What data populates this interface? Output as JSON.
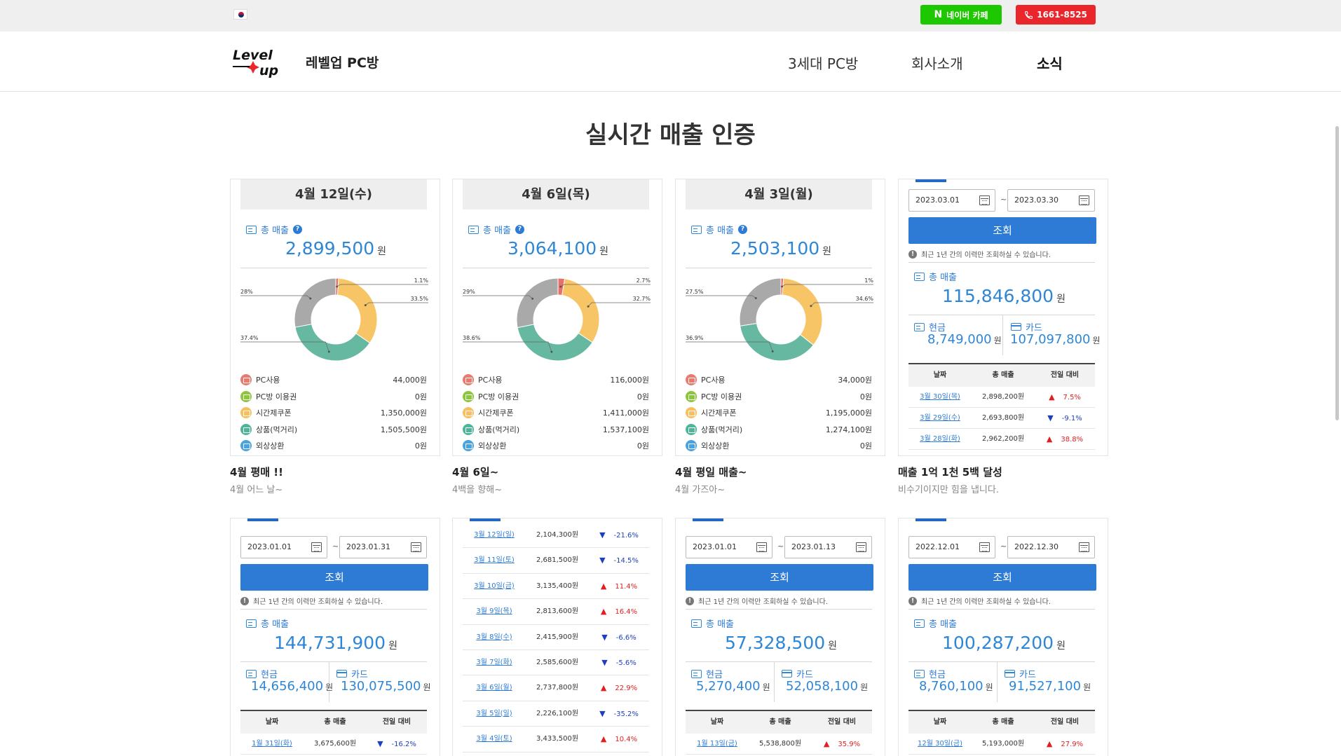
{
  "topbar": {
    "naver_label": "네이버 카페",
    "phone_label": "1661-8525"
  },
  "header": {
    "brand": "레벨업 PC방",
    "nav": [
      "3세대 PC방",
      "회사소개",
      "소식"
    ],
    "active_nav": "소식"
  },
  "page_title": "실시간 매출 인증",
  "total_label": "총 매출",
  "won": "원",
  "legend_labels": [
    "PC사용",
    "PC방 이용권",
    "시간제쿠폰",
    "상품(먹거리)",
    "외상상환"
  ],
  "legend_colors": [
    "#e87a6e",
    "#8cc63f",
    "#f7bf5e",
    "#4fb59a",
    "#4aa3df"
  ],
  "chart_colors": {
    "pc": "#e8706a",
    "coupon": "#f7c565",
    "goods": "#67b8a0",
    "other": "#a9a9a9"
  },
  "daily_cards": [
    {
      "date": "4월 12일(수)",
      "total": "2,899,500",
      "amounts": [
        "44,000원",
        "0원",
        "1,350,000원",
        "1,505,500원",
        "0원"
      ],
      "pcts": {
        "pc": "1.1%",
        "coupon": "33.5%",
        "goods": "37.4%",
        "other": "28%"
      },
      "pct_values": [
        1.1,
        33.5,
        37.4,
        28
      ],
      "caption_title": "4월 평매 !!",
      "caption_sub": "4월 어느 날~"
    },
    {
      "date": "4월 6일(목)",
      "total": "3,064,100",
      "amounts": [
        "116,000원",
        "0원",
        "1,411,000원",
        "1,537,100원",
        "0원"
      ],
      "pcts": {
        "pc": "2.7%",
        "coupon": "32.7%",
        "goods": "38.6%",
        "other": "29%"
      },
      "pct_values": [
        2.7,
        32.7,
        38.6,
        29
      ],
      "caption_title": "4월 6일~",
      "caption_sub": "4백을 향해~"
    },
    {
      "date": "4월 3일(월)",
      "total": "2,503,100",
      "amounts": [
        "34,000원",
        "0원",
        "1,195,000원",
        "1,274,100원",
        "0원"
      ],
      "pcts": {
        "pc": "1%",
        "coupon": "34.6%",
        "goods": "36.9%",
        "other": "27.5%"
      },
      "pct_values": [
        1,
        34.6,
        36.9,
        27.5
      ],
      "caption_title": "4월 평일 매출~",
      "caption_sub": "4월 가즈아~"
    }
  ],
  "range_labels": {
    "search": "조회",
    "notice": "최근 1년 간의 이력만 조회하실 수 있습니다.",
    "cash": "현금",
    "card": "카드",
    "col_date": "날짜",
    "col_total": "총 매출",
    "col_compare": "전일 대비"
  },
  "range_card_march": {
    "start": "2023.03.01",
    "end": "2023.03.30",
    "total": "115,846,800",
    "cash": "8,749,000",
    "card": "107,097,800",
    "rows": [
      {
        "date": "3월 30일(목)",
        "total": "2,898,200원",
        "dir": "up",
        "change": "7.5%"
      },
      {
        "date": "3월 29일(수)",
        "total": "2,693,800원",
        "dir": "down",
        "change": "-9.1%"
      },
      {
        "date": "3월 28일(화)",
        "total": "2,962,200원",
        "dir": "up",
        "change": "38.8%"
      }
    ],
    "caption_title": "매출 1억 1천 5백 달성",
    "caption_sub": "비수기이지만 힘을 냅니다."
  },
  "range_card_jan": {
    "start": "2023.01.01",
    "end": "2023.01.31",
    "total": "144,731,900",
    "cash": "14,656,400",
    "card": "130,075,500",
    "rows": [
      {
        "date": "1월 31일(화)",
        "total": "3,675,600원",
        "dir": "down",
        "change": "-16.2%"
      }
    ]
  },
  "list_card": {
    "rows": [
      {
        "date": "3월 12일(일)",
        "total": "2,104,300원",
        "dir": "down",
        "change": "-21.6%"
      },
      {
        "date": "3월 11일(토)",
        "total": "2,681,500원",
        "dir": "down",
        "change": "-14.5%"
      },
      {
        "date": "3월 10일(금)",
        "total": "3,135,400원",
        "dir": "up",
        "change": "11.4%"
      },
      {
        "date": "3월 9일(목)",
        "total": "2,813,600원",
        "dir": "up",
        "change": "16.4%"
      },
      {
        "date": "3월 8일(수)",
        "total": "2,415,900원",
        "dir": "down",
        "change": "-6.6%"
      },
      {
        "date": "3월 7일(화)",
        "total": "2,585,600원",
        "dir": "down",
        "change": "-5.6%"
      },
      {
        "date": "3월 6일(월)",
        "total": "2,737,800원",
        "dir": "up",
        "change": "22.9%"
      },
      {
        "date": "3월 5일(일)",
        "total": "2,226,100원",
        "dir": "down",
        "change": "-35.2%"
      },
      {
        "date": "3월 4일(토)",
        "total": "3,433,500원",
        "dir": "up",
        "change": "10.4%"
      }
    ]
  },
  "range_card_jan13": {
    "start": "2023.01.01",
    "end": "2023.01.13",
    "total": "57,328,500",
    "cash": "5,270,400",
    "card": "52,058,100",
    "rows": [
      {
        "date": "1월 13일(금)",
        "total": "5,538,800원",
        "dir": "up",
        "change": "35.9%"
      }
    ]
  },
  "range_card_dec": {
    "start": "2022.12.01",
    "end": "2022.12.30",
    "total": "100,287,200",
    "cash": "8,760,100",
    "card": "91,527,100",
    "rows": [
      {
        "date": "12월 30일(금)",
        "total": "5,193,000원",
        "dir": "up",
        "change": "27.9%"
      }
    ]
  }
}
